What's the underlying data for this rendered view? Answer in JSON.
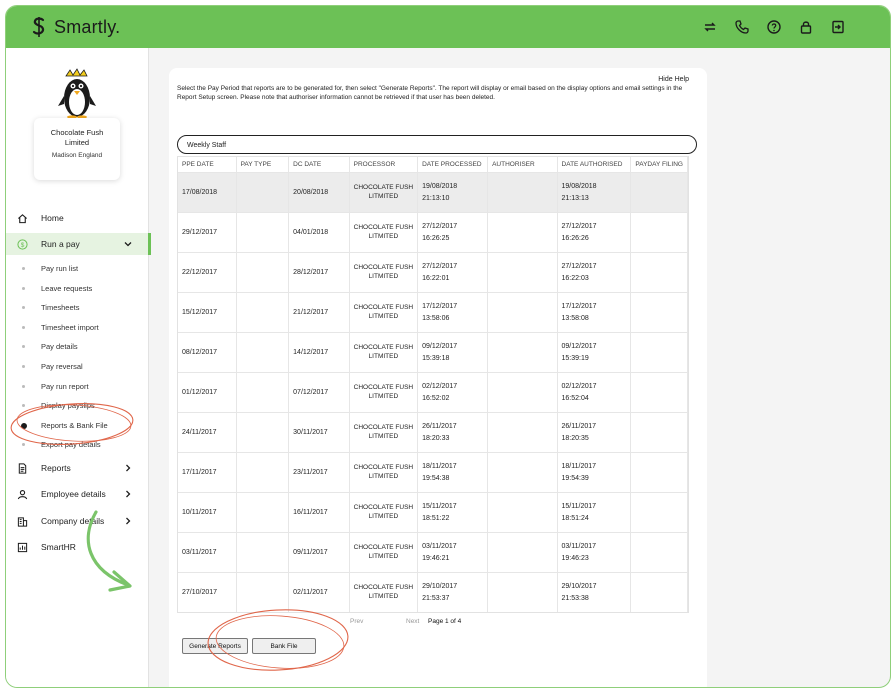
{
  "app": {
    "name": "Smartly."
  },
  "company": {
    "name": "Chocolate Fush Limited",
    "location": "Madison England"
  },
  "nav": {
    "home": "Home",
    "run_a_pay": "Run a pay",
    "sub_items": [
      "Pay run list",
      "Leave requests",
      "Timesheets",
      "Timesheet import",
      "Pay details",
      "Pay reversal",
      "Pay run report",
      "Display payslips",
      "Reports & Bank File",
      "Export pay details"
    ],
    "reports": "Reports",
    "employee_details": "Employee details",
    "company_details": "Company details",
    "smarthr": "SmartHR"
  },
  "main": {
    "hide_help": "Hide Help",
    "instructions": "Select the Pay Period that reports are to be generated for, then select \"Generate Reports\". The report will display or email based on the display options and email settings in the Report Setup screen. Please note that authoriser information cannot be retrieved if that user has been deleted.",
    "period": "Weekly Staff"
  },
  "table": {
    "headers": [
      "PPE DATE",
      "PAY TYPE",
      "DC DATE",
      "PROCESSOR",
      "DATE PROCESSED",
      "AUTHORISER",
      "DATE AUTHORISED",
      "PAYDAY FILING"
    ],
    "rows": [
      {
        "ppe": "17/08/2018",
        "pay_type": "",
        "dc": "20/08/2018",
        "processor": "CHOCOLATE FUSH LITMITED",
        "processed_date": "19/08/2018",
        "processed_time": "21:13:10",
        "authoriser": "",
        "authorised_date": "19/08/2018",
        "authorised_time": "21:13:13",
        "filing": ""
      },
      {
        "ppe": "29/12/2017",
        "pay_type": "",
        "dc": "04/01/2018",
        "processor": "CHOCOLATE FUSH LITMITED",
        "processed_date": "27/12/2017",
        "processed_time": "16:26:25",
        "authoriser": "",
        "authorised_date": "27/12/2017",
        "authorised_time": "16:26:26",
        "filing": ""
      },
      {
        "ppe": "22/12/2017",
        "pay_type": "",
        "dc": "28/12/2017",
        "processor": "CHOCOLATE FUSH LITMITED",
        "processed_date": "27/12/2017",
        "processed_time": "16:22:01",
        "authoriser": "",
        "authorised_date": "27/12/2017",
        "authorised_time": "16:22:03",
        "filing": ""
      },
      {
        "ppe": "15/12/2017",
        "pay_type": "",
        "dc": "21/12/2017",
        "processor": "CHOCOLATE FUSH LITMITED",
        "processed_date": "17/12/2017",
        "processed_time": "13:58:06",
        "authoriser": "",
        "authorised_date": "17/12/2017",
        "authorised_time": "13:58:08",
        "filing": ""
      },
      {
        "ppe": "08/12/2017",
        "pay_type": "",
        "dc": "14/12/2017",
        "processor": "CHOCOLATE FUSH LITMITED",
        "processed_date": "09/12/2017",
        "processed_time": "15:39:18",
        "authoriser": "",
        "authorised_date": "09/12/2017",
        "authorised_time": "15:39:19",
        "filing": ""
      },
      {
        "ppe": "01/12/2017",
        "pay_type": "",
        "dc": "07/12/2017",
        "processor": "CHOCOLATE FUSH LITMITED",
        "processed_date": "02/12/2017",
        "processed_time": "16:52:02",
        "authoriser": "",
        "authorised_date": "02/12/2017",
        "authorised_time": "16:52:04",
        "filing": ""
      },
      {
        "ppe": "24/11/2017",
        "pay_type": "",
        "dc": "30/11/2017",
        "processor": "CHOCOLATE FUSH LITMITED",
        "processed_date": "26/11/2017",
        "processed_time": "18:20:33",
        "authoriser": "",
        "authorised_date": "26/11/2017",
        "authorised_time": "18:20:35",
        "filing": ""
      },
      {
        "ppe": "17/11/2017",
        "pay_type": "",
        "dc": "23/11/2017",
        "processor": "CHOCOLATE FUSH LITMITED",
        "processed_date": "18/11/2017",
        "processed_time": "19:54:38",
        "authoriser": "",
        "authorised_date": "18/11/2017",
        "authorised_time": "19:54:39",
        "filing": ""
      },
      {
        "ppe": "10/11/2017",
        "pay_type": "",
        "dc": "16/11/2017",
        "processor": "CHOCOLATE FUSH LITMITED",
        "processed_date": "15/11/2017",
        "processed_time": "18:51:22",
        "authoriser": "",
        "authorised_date": "15/11/2017",
        "authorised_time": "18:51:24",
        "filing": ""
      },
      {
        "ppe": "03/11/2017",
        "pay_type": "",
        "dc": "09/11/2017",
        "processor": "CHOCOLATE FUSH LITMITED",
        "processed_date": "03/11/2017",
        "processed_time": "19:46:21",
        "authoriser": "",
        "authorised_date": "03/11/2017",
        "authorised_time": "19:46:23",
        "filing": ""
      },
      {
        "ppe": "27/10/2017",
        "pay_type": "",
        "dc": "02/11/2017",
        "processor": "CHOCOLATE FUSH LITMITED",
        "processed_date": "29/10/2017",
        "processed_time": "21:53:37",
        "authoriser": "",
        "authorised_date": "29/10/2017",
        "authorised_time": "21:53:38",
        "filing": ""
      }
    ]
  },
  "pager": {
    "prev": "Prev",
    "next": "Next",
    "page_info": "Page 1 of 4"
  },
  "buttons": {
    "generate": "Generate Reports",
    "bank_file": "Bank File"
  },
  "colors": {
    "brand": "#6cc156",
    "annotation": "#e0664a",
    "arrow": "#7bc46a"
  }
}
